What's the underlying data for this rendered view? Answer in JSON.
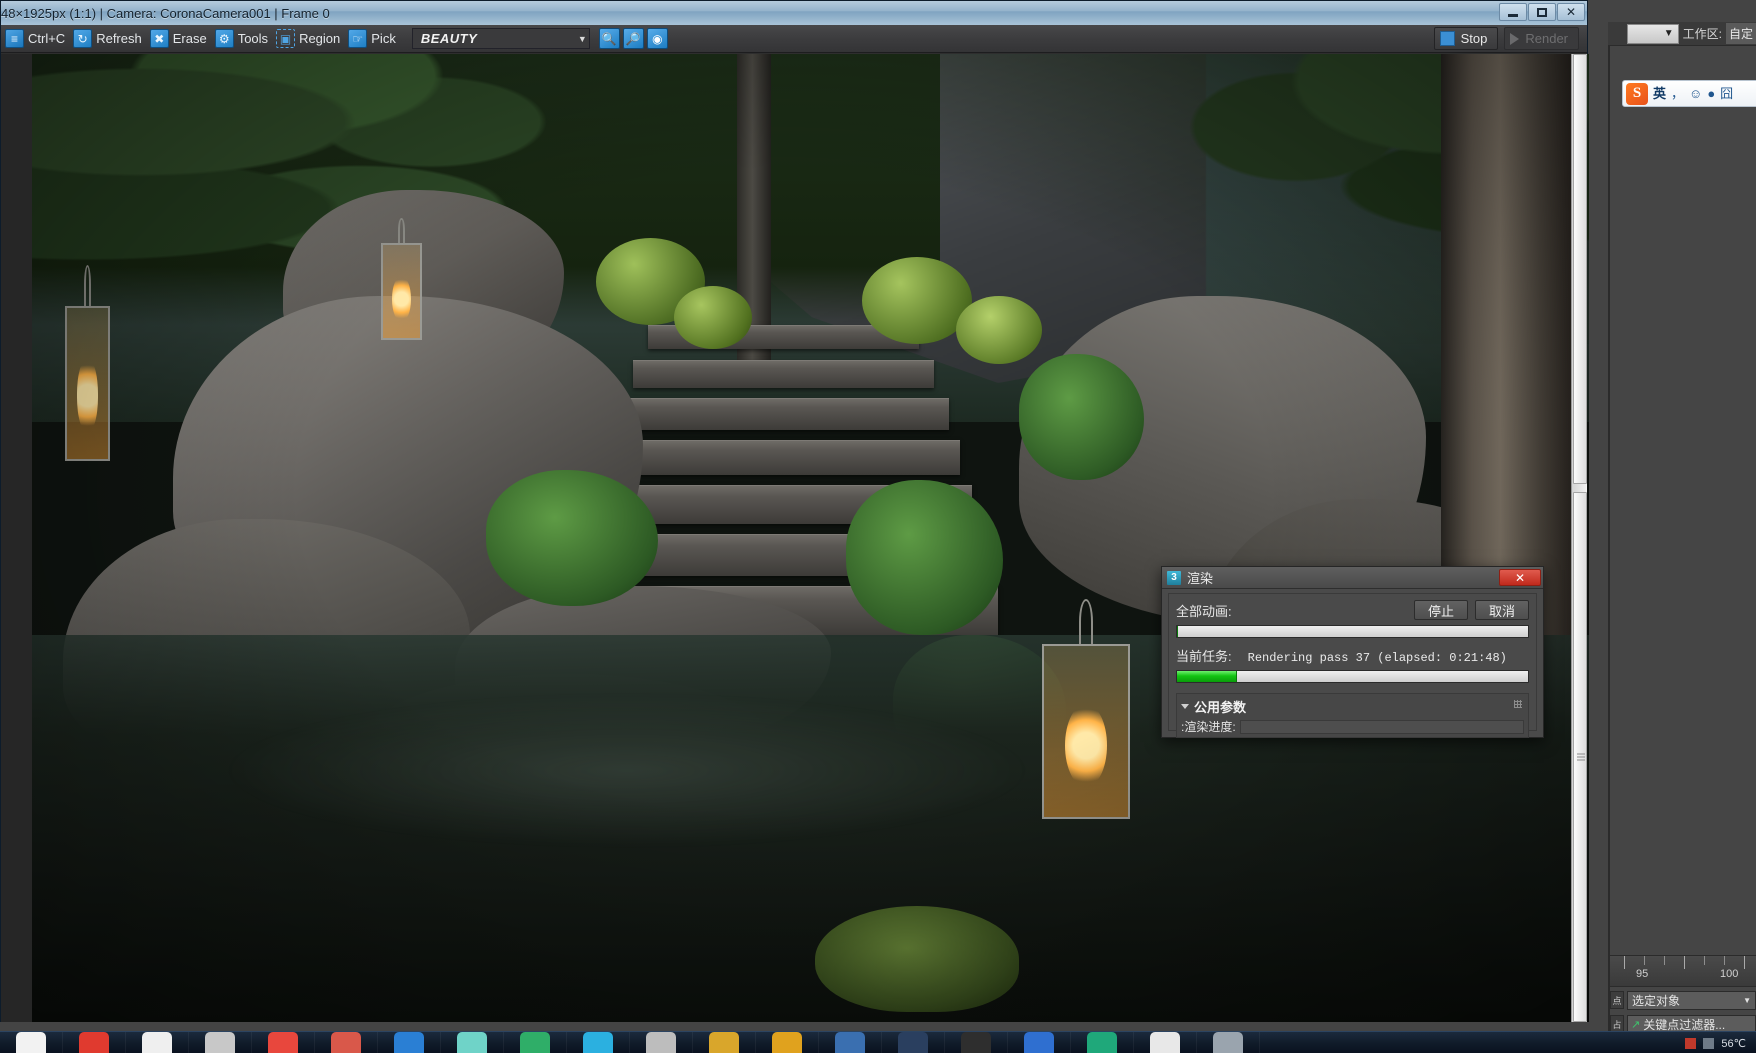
{
  "vfb": {
    "title": "48×1925px (1:1) | Camera: CoronaCamera001 | Frame 0",
    "window_controls": {
      "minimize": "_",
      "maximize": "□",
      "close": "✕"
    },
    "toolbar": {
      "items": [
        {
          "label": "Ctrl+C",
          "icon": "lines-icon"
        },
        {
          "label": "Refresh",
          "icon": "refresh-icon"
        },
        {
          "label": "Erase",
          "icon": "erase-icon"
        },
        {
          "label": "Tools",
          "icon": "gear-icon"
        },
        {
          "label": "Region",
          "icon": "region-icon"
        },
        {
          "label": "Pick",
          "icon": "pick-icon"
        }
      ],
      "pass_selected": "BEAUTY",
      "zoom_buttons": [
        "zoom-in-icon",
        "zoom-out-icon",
        "zoom-fit-icon"
      ],
      "stop_label": "Stop",
      "render_label": "Render"
    }
  },
  "dialog": {
    "title": "渲染",
    "icon_label": "3",
    "close_label": "✕",
    "all_animation_label": "全部动画:",
    "stop_button": "停止",
    "cancel_button": "取消",
    "all_animation_progress_pct": 0,
    "current_task_label": "当前任务:",
    "current_task_value": "Rendering pass 37 (elapsed: 0:21:48)",
    "current_task_progress_pct": 17,
    "rollout_title": "公用参数",
    "rollout_sub_label": ":渲染进度:"
  },
  "max": {
    "workspace_label": "工作区:",
    "workspace_value": "自定",
    "timeline": {
      "ticks": [
        "95",
        "100"
      ]
    },
    "selection_filter": "选定对象",
    "key_filter_button": "关键点过滤器...",
    "combo_caret": "▼"
  },
  "ime": {
    "logo": "S",
    "mode": "英",
    "items": [
      "，",
      "☺",
      "🎤",
      "囧"
    ]
  },
  "taskbar": {
    "icons": [
      {
        "name": "twitter-icon",
        "color": "#f2f2f2"
      },
      {
        "name": "youtube-icon",
        "color": "#e03a2f"
      },
      {
        "name": "folder-icon",
        "color": "#efefef"
      },
      {
        "name": "explorer-icon",
        "color": "#c8c8c8"
      },
      {
        "name": "opera-icon",
        "color": "#e8473d"
      },
      {
        "name": "traffic-cone-icon",
        "color": "#d9584a"
      },
      {
        "name": "edge-icon",
        "color": "#2a7fd4"
      },
      {
        "name": "sparkle-icon",
        "color": "#6fd3c8"
      },
      {
        "name": "wechat-icon",
        "color": "#2fae68"
      },
      {
        "name": "tencent-icon",
        "color": "#2bb0e0"
      },
      {
        "name": "app10-icon",
        "color": "#bdbdbd"
      },
      {
        "name": "app11-icon",
        "color": "#d9a62b"
      },
      {
        "name": "max-icon",
        "color": "#e0a21e"
      },
      {
        "name": "app13-icon",
        "color": "#3a6fb0"
      },
      {
        "name": "photoshop-icon",
        "color": "#2a3f5f"
      },
      {
        "name": "app15-icon",
        "color": "#2e2e2e"
      },
      {
        "name": "office-icon",
        "color": "#2f6fd0"
      },
      {
        "name": "app17-icon",
        "color": "#1fa87a"
      },
      {
        "name": "app18-icon",
        "color": "#e8e8e8"
      },
      {
        "name": "app19-icon",
        "color": "#9aa4ae"
      }
    ],
    "tray_temp": "56℃"
  },
  "scene": {
    "steps_count": 7
  },
  "colors": {
    "accent_blue": "#3b8fd4",
    "progress_green": "#12c412",
    "close_red": "#c0291c",
    "title_gradient_top": "#b5cbdd"
  }
}
